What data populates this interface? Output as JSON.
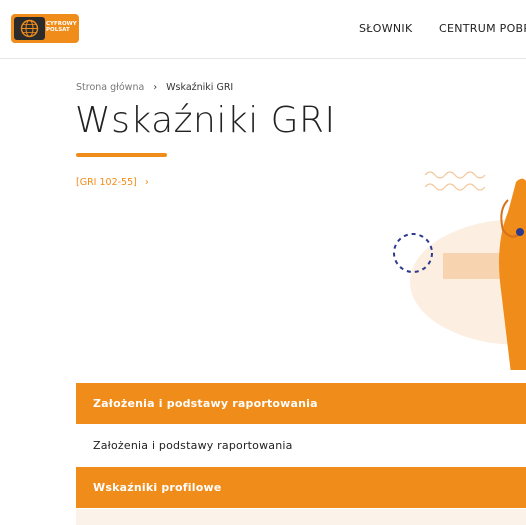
{
  "header": {
    "logo_line1": "CYFROWY",
    "logo_line2": "POLSAT",
    "nav": [
      {
        "label": "SŁOWNIK"
      },
      {
        "label": "CENTRUM POBR"
      }
    ]
  },
  "breadcrumb": {
    "home": "Strona główna",
    "separator": "›",
    "current": "Wskaźniki GRI"
  },
  "page_title": "Wskaźniki GRI",
  "gri_link": {
    "label": "[GRI 102-55]",
    "chevron": "›"
  },
  "accordion": [
    {
      "label": "Założenia i podstawy raportowania",
      "style": "orange"
    },
    {
      "label": "Założenia i podstawy raportowania",
      "style": "white"
    },
    {
      "label": "Wskaźniki profilowe",
      "style": "orange"
    }
  ],
  "colors": {
    "accent": "#f08c1a",
    "text": "#222222",
    "muted": "#777777",
    "illustration_bg": "#fcefe2",
    "circle": "#2d3a8c"
  }
}
